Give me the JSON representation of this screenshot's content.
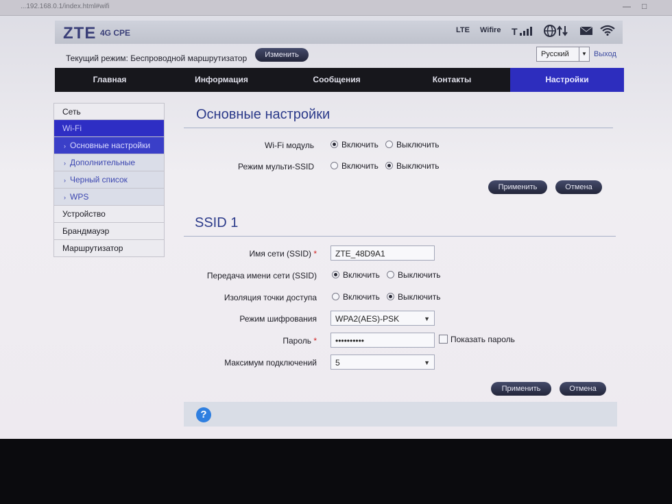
{
  "browser": {
    "tab_text": "...192.168.0.1/index.html#wifi"
  },
  "header": {
    "logo": "ZTE",
    "product": "4G CPE",
    "network_type": "LTE",
    "wifi_status": "Wifire"
  },
  "mode": {
    "label": "Текущий режим: Беспроводной маршрутизатор",
    "change_button": "Изменить",
    "language": "Русский",
    "logout": "Выход"
  },
  "nav": {
    "items": [
      "Главная",
      "Информация",
      "Сообщения",
      "Контакты",
      "Настройки"
    ],
    "active": "Настройки"
  },
  "sidebar": {
    "items": [
      {
        "label": "Сеть"
      },
      {
        "label": "Wi-Fi"
      },
      {
        "label": "Основные настройки"
      },
      {
        "label": "Дополнительные"
      },
      {
        "label": "Черный список"
      },
      {
        "label": "WPS"
      },
      {
        "label": "Устройство"
      },
      {
        "label": "Брандмауэр"
      },
      {
        "label": "Маршрутизатор"
      }
    ]
  },
  "basic": {
    "title": "Основные настройки",
    "wifi_module_label": "Wi-Fi модуль",
    "multi_ssid_label": "Режим мульти-SSID",
    "on": "Включить",
    "off": "Выключить",
    "apply": "Применить",
    "cancel": "Отмена"
  },
  "ssid": {
    "title": "SSID 1",
    "name_label": "Имя сети (SSID)",
    "name_value": "ZTE_48D9A1",
    "broadcast_label": "Передача имени сети (SSID)",
    "isolation_label": "Изоляция точки доступа",
    "encryption_label": "Режим шифрования",
    "encryption_value": "WPA2(AES)-PSK",
    "password_label": "Пароль",
    "password_value": "••••••••••",
    "show_password": "Показать пароль",
    "max_label": "Максимум подключений",
    "max_value": "5",
    "required_mark": "*",
    "on": "Включить",
    "off": "Выключить",
    "apply": "Применить",
    "cancel": "Отмена"
  },
  "help": {
    "icon": "?"
  }
}
